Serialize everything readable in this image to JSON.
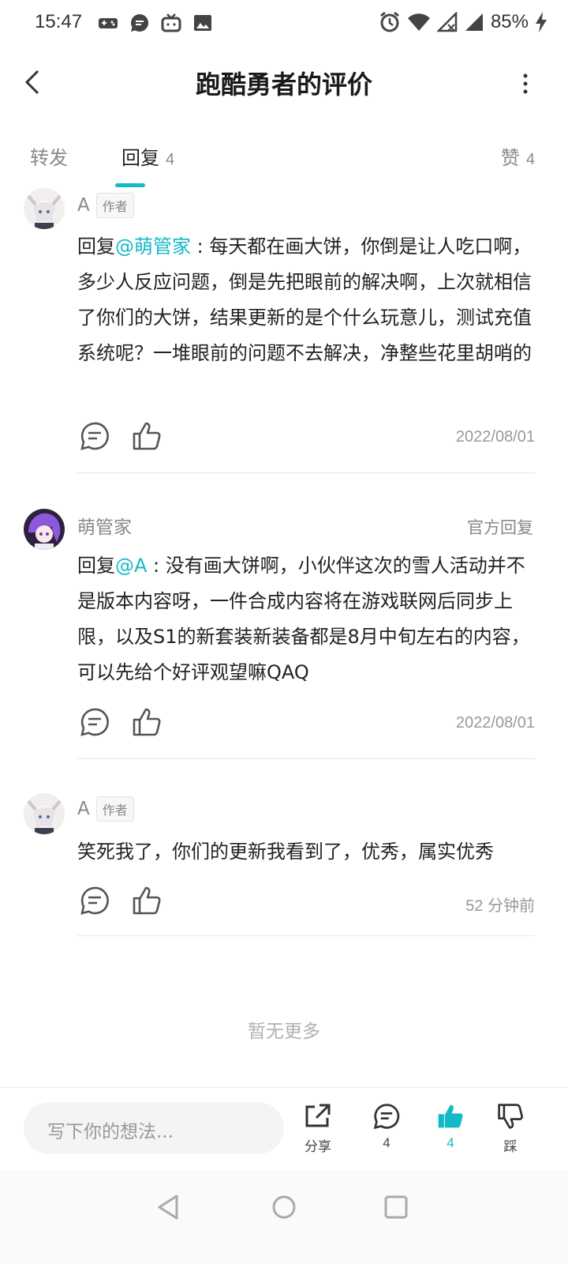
{
  "status_bar": {
    "time": "15:47",
    "battery": "85%",
    "left_icons": [
      "game-controller-icon",
      "chat-bubble-icon",
      "tv-icon",
      "image-icon"
    ],
    "right_icons": [
      "alarm-icon",
      "wifi-icon",
      "no-signal-icon",
      "signal-icon",
      "charging-icon"
    ]
  },
  "header": {
    "title": "跑酷勇者的评价",
    "back_icon": "chevron-left-icon",
    "more_icon": "more-vertical-icon"
  },
  "tabs": {
    "repost": "转发",
    "reply": "回复",
    "reply_count": "4",
    "like": "赞",
    "like_count": "4",
    "accent_color": "#14b9c8"
  },
  "comments": [
    {
      "author": "A",
      "badge": "作者",
      "reply_prefix": "回复",
      "mention": "@萌管家",
      "text": " : 每天都在画大饼，你倒是让人吃口啊，多少人反应问题，倒是先把眼前的解决啊，上次就相信了你们的大饼，结果更新的是个什么玩意儿，测试充值系统呢？一堆眼前的问题不去解决，净整些花里胡哨的",
      "time": "2022/08/01"
    },
    {
      "author": "萌管家",
      "tag": "官方回复",
      "reply_prefix": "回复",
      "mention": "@A",
      "text": " : 没有画大饼啊，小伙伴这次的雪人活动并不是版本内容呀，一件合成内容将在游戏联网后同步上限，以及S1的新套装新装备都是8月中旬左右的内容，可以先给个好评观望嘛QAQ",
      "time": "2022/08/01"
    },
    {
      "author": "A",
      "badge": "作者",
      "text": "笑死我了，你们的更新我看到了，优秀，属实优秀",
      "time": "52 分钟前"
    }
  ],
  "no_more": "暂无更多",
  "bottom_bar": {
    "input_placeholder": "写下你的想法...",
    "share_label": "分享",
    "reply_count": "4",
    "like_count": "4",
    "dislike_label": "踩"
  }
}
